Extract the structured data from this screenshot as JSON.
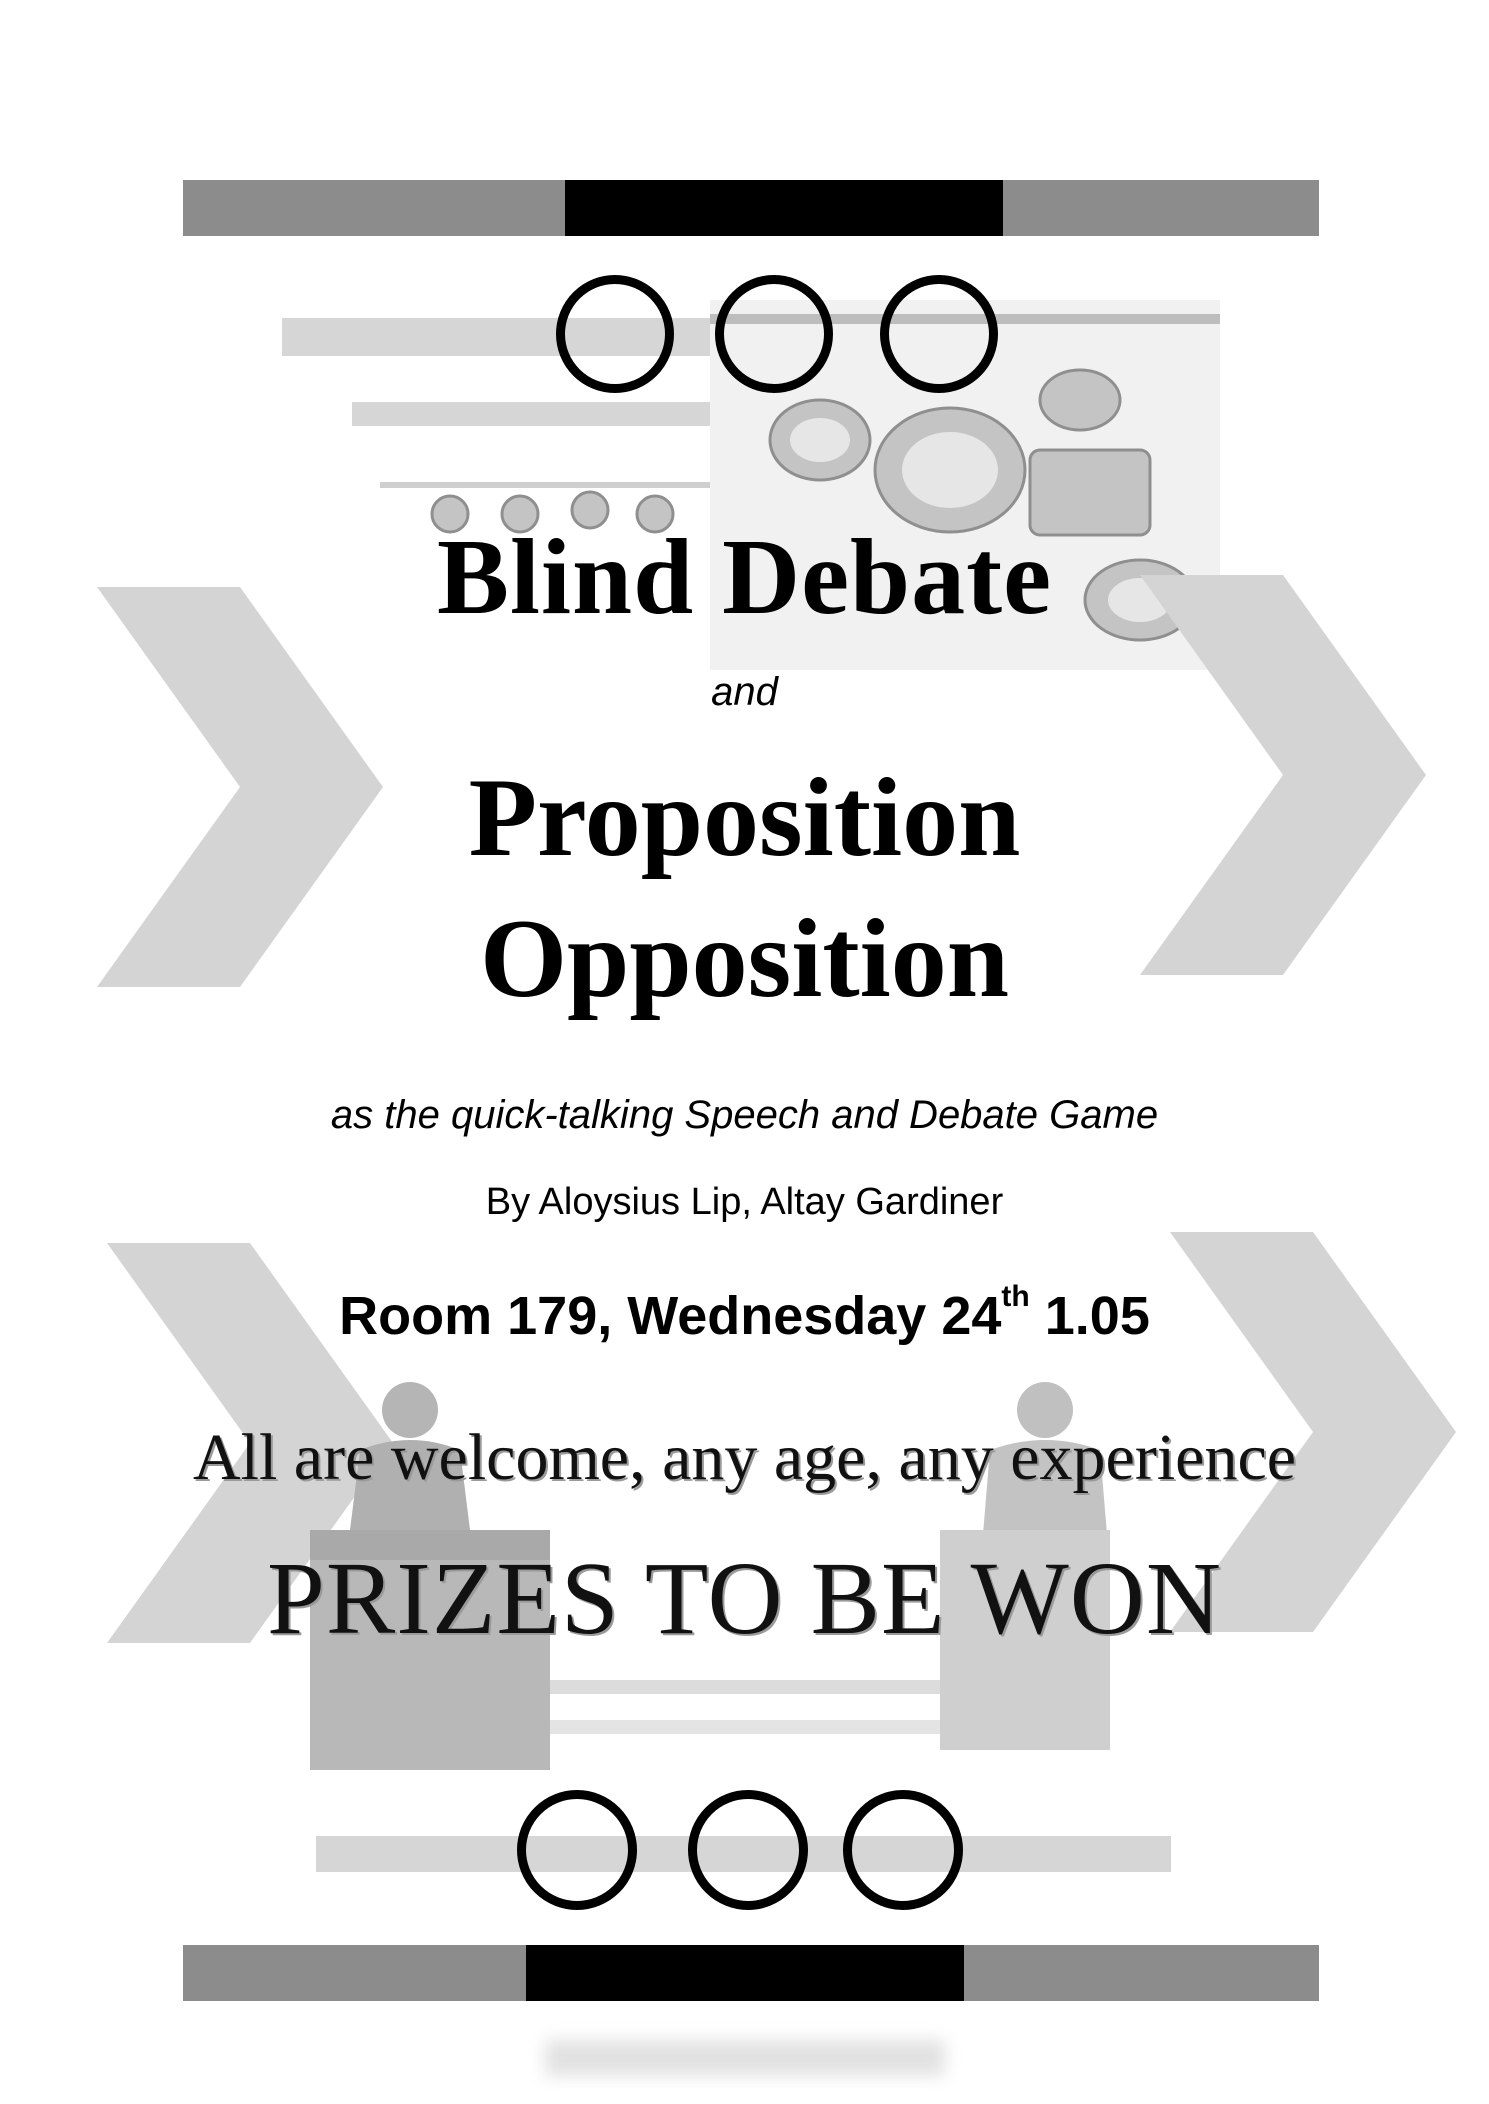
{
  "poster": {
    "title": "Blind Debate",
    "connector": "and",
    "title_line2": "Proposition",
    "title_line3": "Opposition",
    "tagline": "as the quick-talking Speech and Debate Game",
    "authors": "By Aloysius Lip, Altay Gardiner",
    "venue": {
      "prefix": "Room 179, Wednesday 24",
      "suffix": "th",
      "time": "1.05"
    },
    "welcome": "All are welcome, any age, any experience",
    "prizes": "PRIZES TO BE WON"
  },
  "colors": {
    "bar_gray": "#8c8c8c",
    "bar_black": "#000000",
    "decor_light": "#d6d6d6"
  },
  "icons": [
    "stage-lights-icon",
    "speaker-at-podium-icon",
    "chevron-right-icon",
    "circle-ring-icon"
  ]
}
